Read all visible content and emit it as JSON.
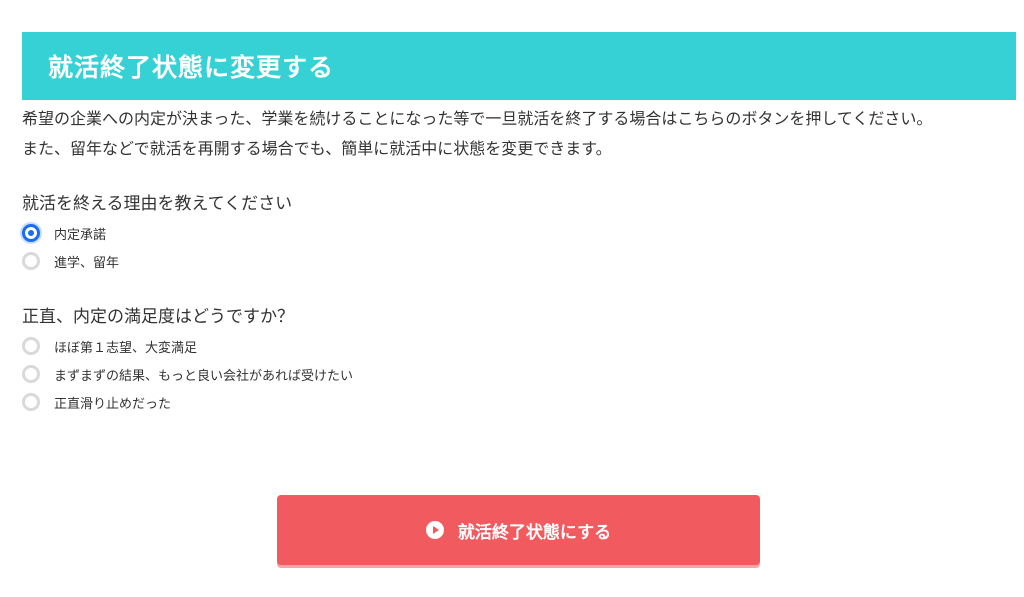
{
  "header": {
    "title": "就活終了状態に変更する"
  },
  "description": {
    "line1": "希望の企業への内定が決まった、学業を続けることになった等で一旦就活を終了する場合はこちらのボタンを押してください。",
    "line2": "また、留年などで就活を再開する場合でも、簡単に就活中に状態を変更できます。"
  },
  "question_reason": {
    "label": "就活を終える理由を教えてください",
    "options": [
      {
        "label": "内定承諾",
        "selected": true
      },
      {
        "label": "進学、留年",
        "selected": false
      }
    ]
  },
  "question_satisfaction": {
    "label": "正直、内定の満足度はどうですか？",
    "options": [
      {
        "label": "ほぼ第１志望、大変満足",
        "selected": false
      },
      {
        "label": "まずまずの結果、もっと良い会社があれば受けたい",
        "selected": false
      },
      {
        "label": "正直滑り止めだった",
        "selected": false
      }
    ]
  },
  "submit": {
    "label": "就活終了状態にする",
    "icon": "play-icon"
  },
  "colors": {
    "header_bg": "#36d1d4",
    "button_bg": "#f15a5f",
    "radio_selected": "#1a6cf2"
  }
}
